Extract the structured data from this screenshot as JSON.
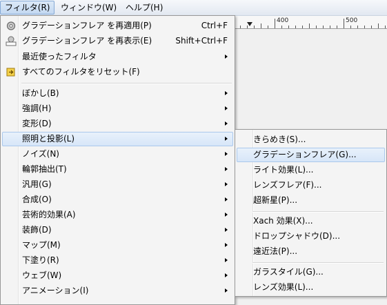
{
  "menubar": {
    "filter": "フィルタ(R)",
    "window": "ウィンドウ(W)",
    "help": "ヘルプ(H)"
  },
  "ruler": {
    "label_400": "400",
    "label_500": "500"
  },
  "main_menu": {
    "repeat": "グラデーションフレア を再適用(P)",
    "repeat_sc": "Ctrl+F",
    "reshow": "グラデーションフレア を再表示(E)",
    "reshow_sc": "Shift+Ctrl+F",
    "recent": "最近使ったフィルタ",
    "reset": "すべてのフィルタをリセット(F)",
    "blur": "ぼかし(B)",
    "enhance": "強調(H)",
    "distorts": "変形(D)",
    "light_shadow": "照明と投影(L)",
    "noise": "ノイズ(N)",
    "edge_detect": "輪郭抽出(T)",
    "generic": "汎用(G)",
    "combine": "合成(O)",
    "artistic": "芸術的効果(A)",
    "decor": "装飾(D)",
    "map": "マップ(M)",
    "render": "下塗り(R)",
    "web": "ウェブ(W)",
    "animation": "アニメーション(I)"
  },
  "sub_menu": {
    "sparkle": "きらめき(S)...",
    "gradient_flare": "グラデーションフレア(G)...",
    "lighting": "ライト効果(L)...",
    "lens_flare": "レンズフレア(F)...",
    "supernova": "超新星(P)...",
    "xach": "Xach 効果(X)...",
    "drop_shadow": "ドロップシャドウ(D)...",
    "perspective": "遠近法(P)...",
    "glass_tile": "ガラスタイル(G)...",
    "lens_effect": "レンズ効果(L)..."
  },
  "icons": {
    "repeat": "gear-repeat-icon",
    "reshow": "gear-reshow-icon",
    "reset": "reset-icon"
  },
  "colors": {
    "highlight_border": "#aac8ec",
    "highlight_bg": "#d7e6f8"
  }
}
